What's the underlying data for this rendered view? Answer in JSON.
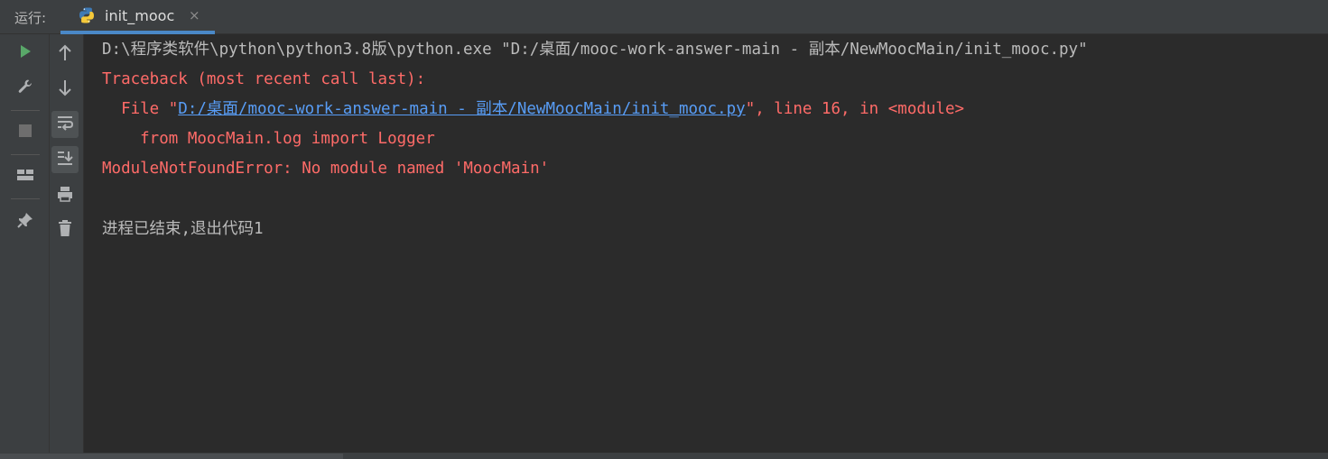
{
  "header": {
    "run_label": "运行:",
    "tab": {
      "label": "init_mooc",
      "close": "×",
      "icon": "python-icon"
    }
  },
  "toolbar": {
    "left": [
      "run-icon",
      "wrench-icon",
      "stop-icon",
      "layout-icon",
      "pin-icon"
    ],
    "right": [
      "arrow-up-icon",
      "arrow-down-icon",
      "soft-wrap-icon",
      "scroll-to-end-icon",
      "print-icon",
      "trash-icon"
    ]
  },
  "console": {
    "command": "D:\\程序类软件\\python\\python3.8版\\python.exe \"D:/桌面/mooc-work-answer-main - 副本/NewMoocMain/init_mooc.py\"",
    "traceback": "Traceback (most recent call last):",
    "file_prefix": "  File \"",
    "file_link": "D:/桌面/mooc-work-answer-main - 副本/NewMoocMain/init_mooc.py",
    "file_suffix": "\", line 16, in <module>",
    "code_line": "    from MoocMain.log import Logger",
    "error": "ModuleNotFoundError: No module named 'MoocMain'",
    "exit_message": "进程已结束,退出代码1"
  },
  "colors": {
    "background": "#2b2b2b",
    "panel": "#3c3f41",
    "text": "#bbbbbb",
    "error": "#ff6b68",
    "link": "#589df6",
    "run_green": "#59a869",
    "tab_underline": "#4a88c7"
  }
}
